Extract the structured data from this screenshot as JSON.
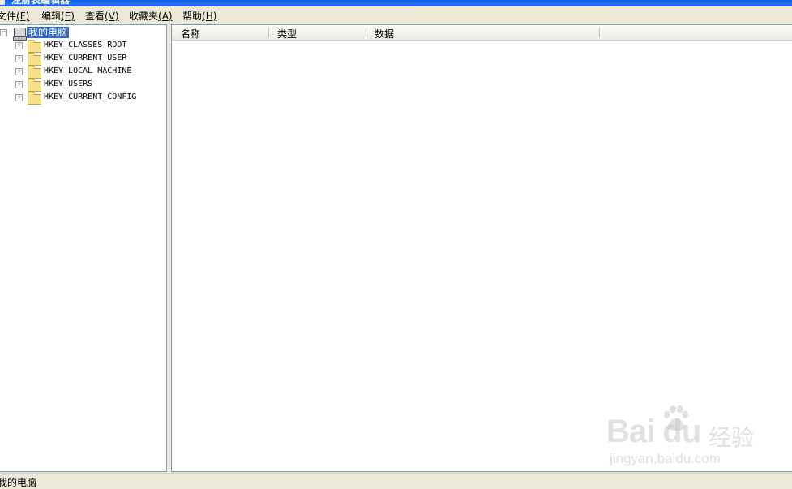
{
  "window": {
    "title": "注册表编辑器"
  },
  "menu": [
    {
      "label": "文件",
      "accel": "(F)"
    },
    {
      "label": "编辑",
      "accel": "(E)"
    },
    {
      "label": "查看",
      "accel": "(V)"
    },
    {
      "label": "收藏夹",
      "accel": "(A)"
    },
    {
      "label": "帮助",
      "accel": "(H)"
    }
  ],
  "tree": {
    "root": {
      "label": "我的电脑",
      "icon": "computer-icon",
      "expander": "−"
    },
    "keys": [
      {
        "label": "HKEY_CLASSES_ROOT",
        "icon": "folder-icon",
        "expander": "+"
      },
      {
        "label": "HKEY_CURRENT_USER",
        "icon": "folder-icon",
        "expander": "+"
      },
      {
        "label": "HKEY_LOCAL_MACHINE",
        "icon": "folder-icon",
        "expander": "+"
      },
      {
        "label": "HKEY_USERS",
        "icon": "folder-icon",
        "expander": "+"
      },
      {
        "label": "HKEY_CURRENT_CONFIG",
        "icon": "folder-icon",
        "expander": "+"
      }
    ]
  },
  "list": {
    "columns": [
      "名称",
      "类型",
      "数据"
    ]
  },
  "status": {
    "text": "我的电脑"
  },
  "watermark": {
    "brand": "Bai du",
    "cn": "经验",
    "url": "jingyan.baidu.com"
  },
  "colors": {
    "selection": "#316ac5",
    "titlebar": "#0a5fe6",
    "chrome": "#ece9d8"
  }
}
